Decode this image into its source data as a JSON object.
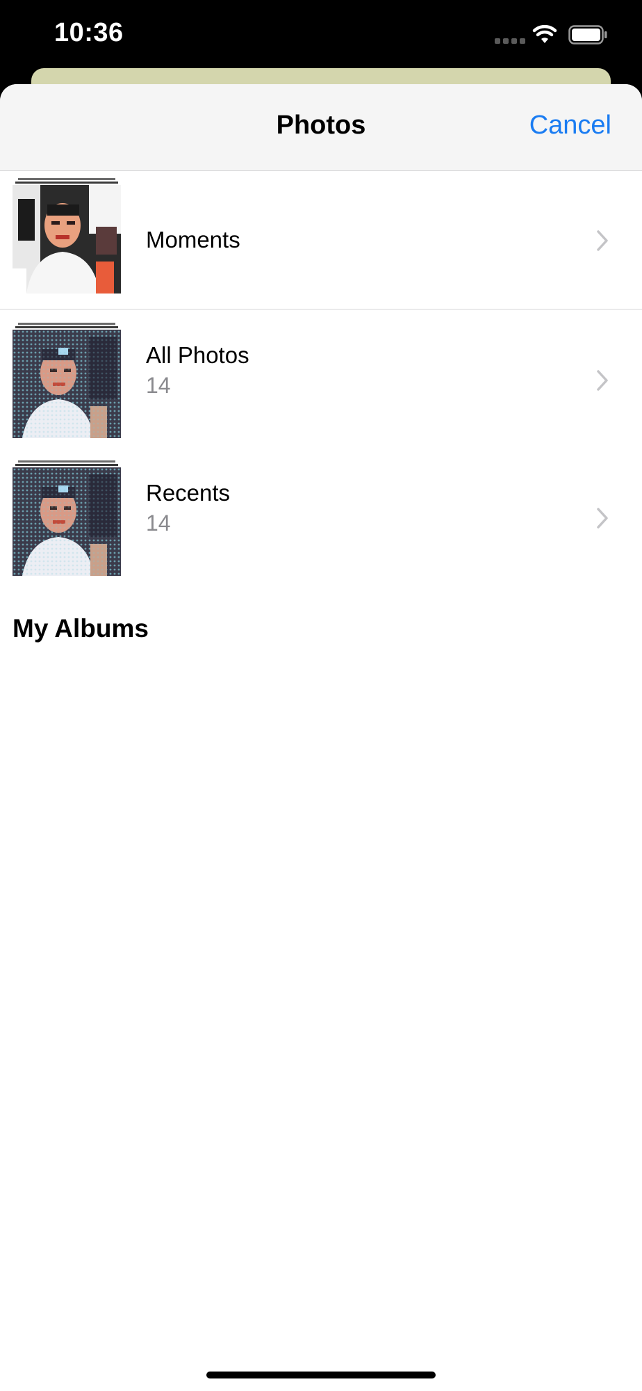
{
  "status_bar": {
    "time": "10:36",
    "icons": [
      "signal-icon",
      "wifi-icon",
      "battery-icon"
    ]
  },
  "nav": {
    "title": "Photos",
    "cancel_label": "Cancel"
  },
  "albums": [
    {
      "title": "Moments",
      "count": "",
      "thumb": "portrait-photo-thumbnail"
    },
    {
      "title": "All Photos",
      "count": "14",
      "thumb": "halftone-portrait-thumbnail"
    },
    {
      "title": "Recents",
      "count": "14",
      "thumb": "halftone-portrait-thumbnail"
    }
  ],
  "section": {
    "my_albums_label": "My Albums"
  },
  "colors": {
    "accent": "#1a7cf2",
    "secondary_text": "#8a8a8e",
    "nav_background": "#f5f5f5",
    "back_sheet": "#d4d6ad"
  }
}
